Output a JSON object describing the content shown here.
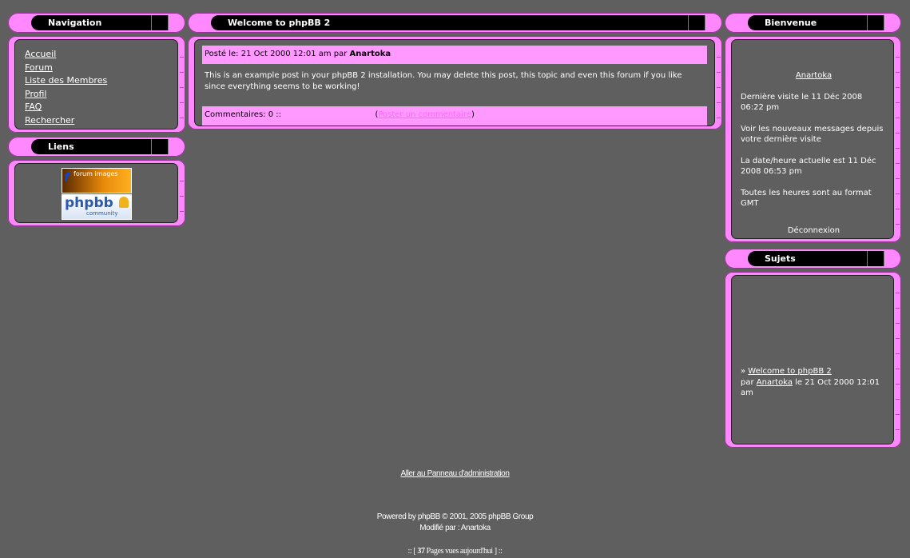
{
  "nav": {
    "title": "Navigation",
    "items": [
      "Accueil",
      "Forum",
      "Liste des Membres",
      "Profil",
      "FAQ",
      "Rechercher"
    ]
  },
  "links": {
    "title": "Liens",
    "banners": [
      {
        "line1": "f",
        "line2": "forum images"
      },
      {
        "line1": "phpbb",
        "line2": "community"
      }
    ]
  },
  "post": {
    "title": "Welcome to phpBB 2",
    "posted_prefix": "Posté le: 21 Oct 2000 12:01 am par ",
    "author": "Anartoka",
    "text": "This is an example post in your phpBB 2 installation. You may delete this post, this topic and even this forum if you like since everything seems to be working!",
    "comments_prefix": "Commentaires: 0 :: ",
    "view_comments": "voir les commentaires",
    "open_paren": " (",
    "post_comment": "Poster un commentaire",
    "close_paren": ")"
  },
  "welcome": {
    "title": "Bienvenue",
    "username": "Anartoka",
    "last_visit": "Dernière visite le 11 Déc 2008 06:22 pm",
    "new_messages": "Voir les nouveaux messages depuis votre dernière visite",
    "current_time": "La date/heure actuelle est 11 Déc 2008 06:53 pm",
    "timezone": "Toutes les heures sont au format GMT",
    "logout": "Déconnexion"
  },
  "topics": {
    "title": "Sujets",
    "bullet": "» ",
    "topic_link": "Welcome to phpBB 2",
    "by": "par ",
    "author": "Anartoka",
    "date": " le 21 Oct 2000 12:01 am"
  },
  "footer": {
    "admin_link": "Aller au Panneau d'administration",
    "powered": "Powered by phpBB © 2001, 2005 phpBB Group",
    "modified": "Modifié par : Anartoka",
    "stats_prefix": ":: [ ",
    "stats_count": "37",
    "stats_suffix": " Pages vues aujourd'hui ] ::"
  }
}
